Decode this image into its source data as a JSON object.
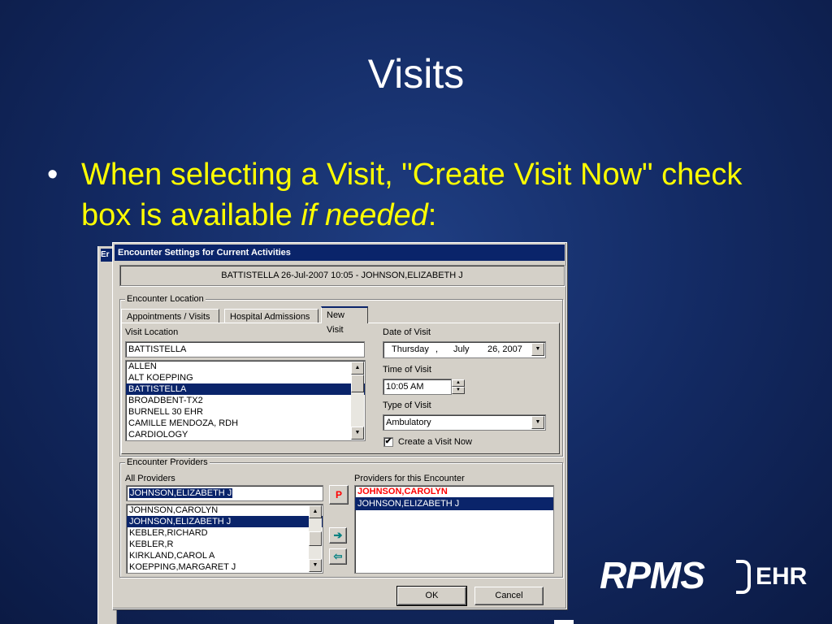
{
  "slide": {
    "title": "Visits",
    "bullet_char": "•",
    "bullet_text": "When selecting a Visit, \"Create Visit Now\" check box is available ",
    "bullet_emphasis": "if needed",
    "bullet_end": ":"
  },
  "bg_window": {
    "title_fragment": "Er"
  },
  "dialog": {
    "title": "Encounter Settings for Current Activities",
    "header_info": "BATTISTELLA  26-Jul-2007 10:05  -  JOHNSON,ELIZABETH J",
    "encounter_location": {
      "group_label": "Encounter Location",
      "tabs": [
        {
          "label": "Appointments / Visits"
        },
        {
          "label": "Hospital Admissions"
        },
        {
          "label": "New Visit"
        }
      ],
      "visit_location_label": "Visit Location",
      "visit_location_value": "BATTISTELLA",
      "locations": [
        {
          "label": "ALLEN"
        },
        {
          "label": "ALT KOEPPING"
        },
        {
          "label": "BATTISTELLA"
        },
        {
          "label": "BROADBENT-TX2"
        },
        {
          "label": "BURNELL 30 EHR"
        },
        {
          "label": "CAMILLE MENDOZA, RDH"
        },
        {
          "label": "CARDIOLOGY"
        }
      ],
      "date_label": "Date of Visit",
      "date_weekday": "Thursday",
      "date_sep": ",",
      "date_month": "July",
      "date_day_year": "26, 2007",
      "time_label": "Time of Visit",
      "time_value": "10:05 AM",
      "type_label": "Type of Visit",
      "type_value": "Ambulatory",
      "create_visit_label": "Create a Visit Now",
      "create_visit_checked": true,
      "check_mark": "✔"
    },
    "encounter_providers": {
      "group_label": "Encounter Providers",
      "all_providers_label": "All Providers",
      "search_value": "JOHNSON,ELIZABETH J",
      "providers": [
        {
          "label": "JOHNSON,CAROLYN"
        },
        {
          "label": "JOHNSON,ELIZABETH J"
        },
        {
          "label": "KEBLER,RICHARD"
        },
        {
          "label": "KEBLER,R"
        },
        {
          "label": "KIRKLAND,CAROL A"
        },
        {
          "label": "KOEPPING,MARGARET J"
        }
      ],
      "primary_button": "P",
      "add_icon": "➔",
      "remove_icon": "⇦",
      "encounter_list_label": "Providers for this Encounter",
      "encounter_providers": [
        {
          "label": "JOHNSON,CAROLYN"
        },
        {
          "label": "JOHNSON,ELIZABETH J"
        }
      ]
    },
    "ok_label": "OK",
    "cancel_label": "Cancel"
  },
  "logo": {
    "rpms": "RPMS",
    "ehr": "EHR"
  },
  "icons": {
    "scroll_up": "▲",
    "scroll_down": "▼",
    "dropdown": "▼",
    "spin_up": "▲",
    "spin_down": "▼"
  },
  "colors": {
    "selection": "#0a246a",
    "primary_provider": "#ff0000",
    "bullet_text": "#ffff00"
  }
}
